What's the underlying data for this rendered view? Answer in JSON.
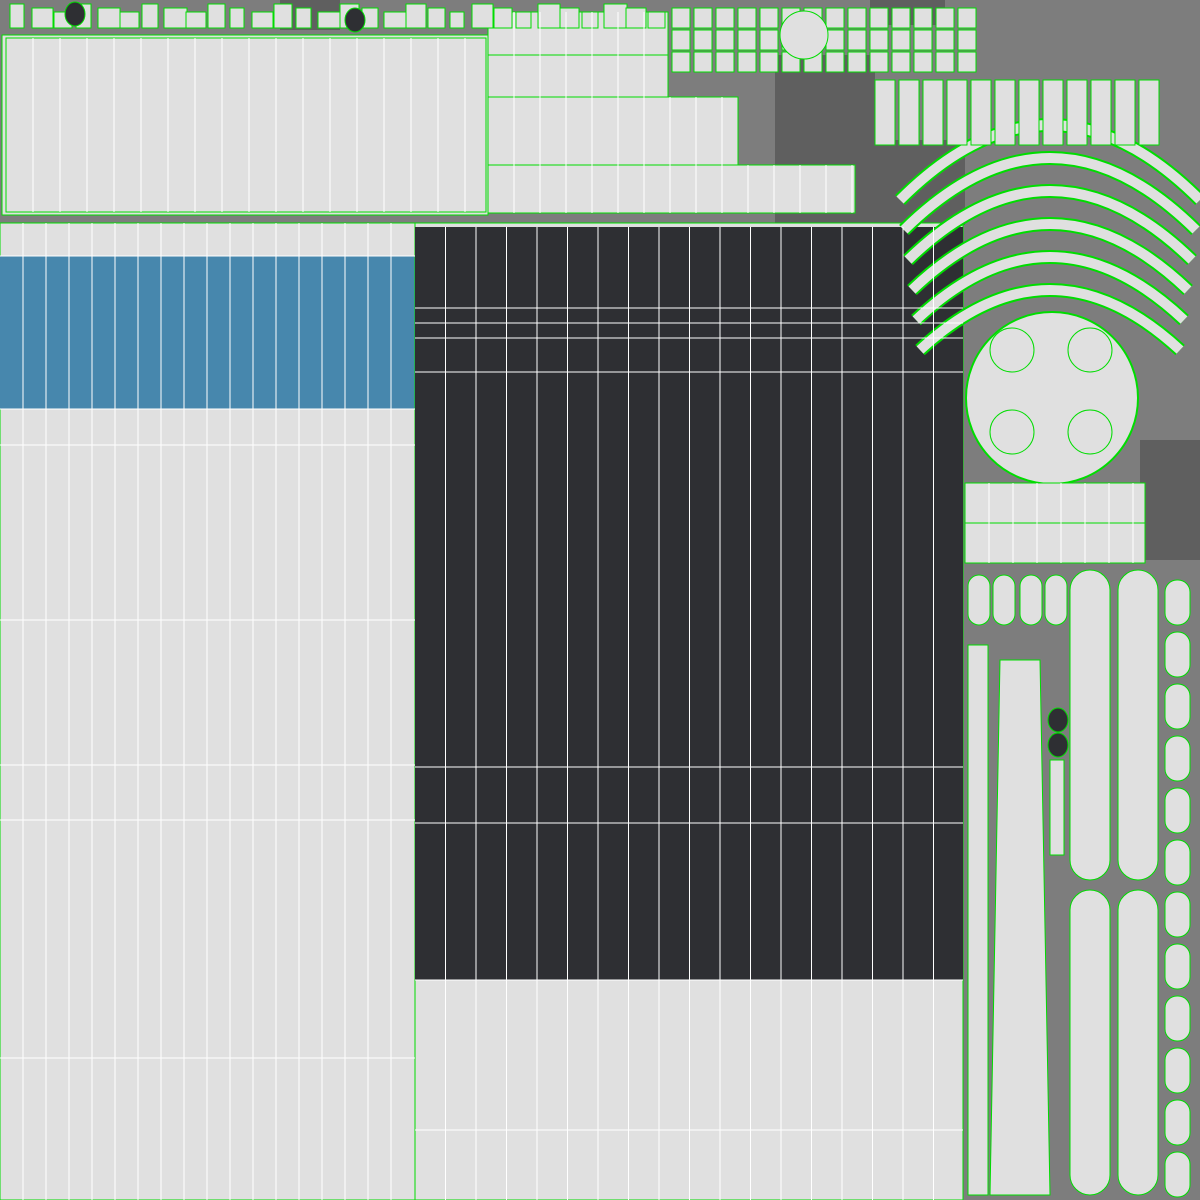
{
  "view": {
    "type": "uv-layout-texture",
    "text_labels": []
  },
  "colors": {
    "background": "#7d7d7d",
    "island_fill": "#e0e0e0",
    "island_outline": "#00dd00",
    "wire_line": "#ffffff",
    "dark_panel": "#2e2f33",
    "blue_band": "#4787ad",
    "shadow_gray": "#5f5f5f"
  },
  "icons": [
    "uv-island",
    "mesh-wire",
    "hatched-swatch"
  ]
}
